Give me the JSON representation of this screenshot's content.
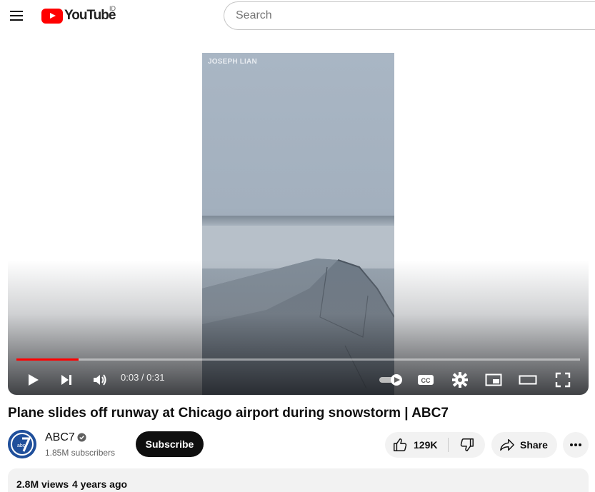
{
  "header": {
    "logo_text": "YouTube",
    "country_code": "ID",
    "search_placeholder": "Search"
  },
  "player": {
    "watermark": "JOSEPH LIAN",
    "current_time": "0:03",
    "separator": " / ",
    "duration": "0:31",
    "progress_fraction": 0.11,
    "progress_color": "#ff0000"
  },
  "video": {
    "title": "Plane slides off runway at Chicago airport during snowstorm | ABC7"
  },
  "channel": {
    "name": "ABC7",
    "subscribers": "1.85M subscribers",
    "subscribe_label": "Subscribe",
    "avatar_text": "abc"
  },
  "actions": {
    "likes": "129K",
    "share_label": "Share"
  },
  "description": {
    "views": "2.8M views",
    "published": "4 years ago"
  },
  "icons": [
    "menu-icon",
    "youtube-logo-icon",
    "play-icon",
    "next-icon",
    "volume-icon",
    "autoplay-toggle-icon",
    "captions-icon",
    "settings-icon",
    "miniplayer-icon",
    "theater-mode-icon",
    "fullscreen-icon",
    "verified-icon",
    "like-icon",
    "dislike-icon",
    "share-icon",
    "more-icon"
  ]
}
